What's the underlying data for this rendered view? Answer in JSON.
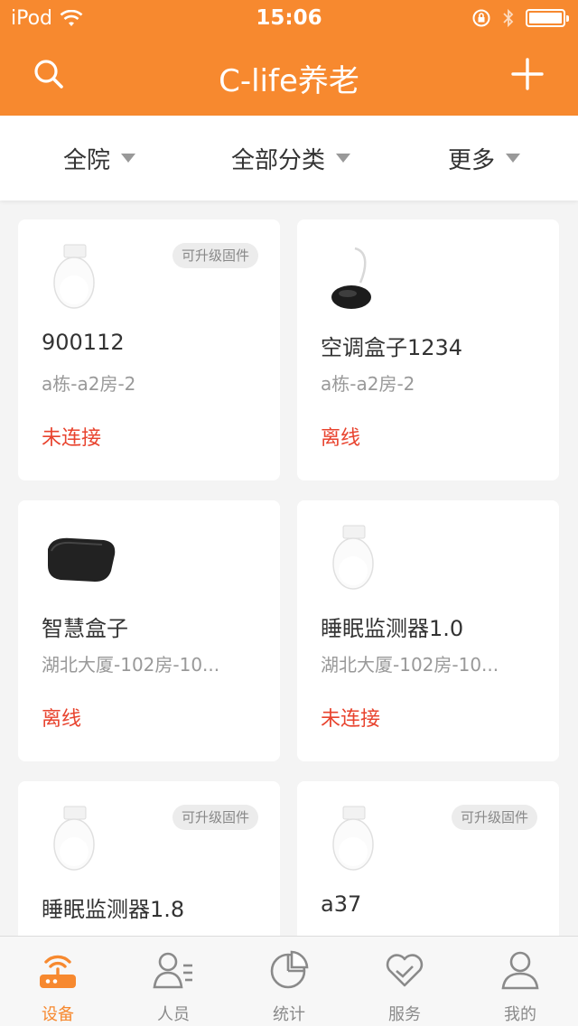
{
  "status_bar": {
    "carrier": "iPod",
    "time": "15:06"
  },
  "nav": {
    "title": "C-life养老"
  },
  "filters": [
    {
      "label": "全院"
    },
    {
      "label": "全部分类"
    },
    {
      "label": "更多"
    }
  ],
  "devices": [
    {
      "name": "900112",
      "location": "a栋-a2房-2",
      "status": "未连接",
      "badge": "可升级固件",
      "image": "white-oval-sensor"
    },
    {
      "name": "空调盒子1234",
      "location": "a栋-a2房-2",
      "status": "离线",
      "badge": "",
      "image": "black-disc-device"
    },
    {
      "name": "智慧盒子",
      "location": "湖北大厦-102房-10...",
      "status": "离线",
      "badge": "",
      "image": "black-box-device"
    },
    {
      "name": "睡眠监测器1.0",
      "location": "湖北大厦-102房-10...",
      "status": "未连接",
      "badge": "",
      "image": "white-oval-sensor"
    },
    {
      "name": "睡眠监测器1.8",
      "location": "",
      "status": "",
      "badge": "可升级固件",
      "image": "white-oval-sensor"
    },
    {
      "name": "a37",
      "location": "",
      "status": "",
      "badge": "可升级固件",
      "image": "white-oval-sensor"
    }
  ],
  "tabs": [
    {
      "label": "设备",
      "icon": "router-icon",
      "active": true
    },
    {
      "label": "人员",
      "icon": "people-list-icon",
      "active": false
    },
    {
      "label": "统计",
      "icon": "pie-chart-icon",
      "active": false
    },
    {
      "label": "服务",
      "icon": "heart-icon",
      "active": false
    },
    {
      "label": "我的",
      "icon": "user-icon",
      "active": false
    }
  ],
  "colors": {
    "accent": "#f7892f",
    "status_red": "#e8432e"
  }
}
